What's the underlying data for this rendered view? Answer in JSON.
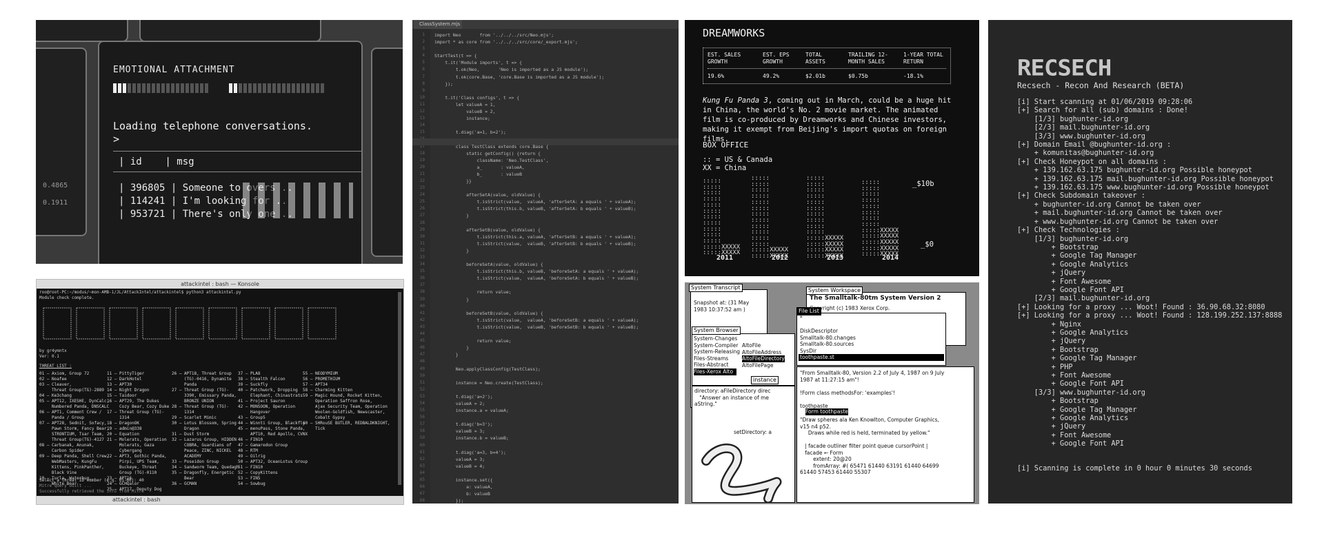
{
  "panel1": {
    "heading": "EMOTIONAL ATTACHMENT",
    "loading": "Loading telephone conversations.",
    "prompt": ">",
    "header": "| id    | msg",
    "rows": [
      "| 396805 | Someone to overs ..",
      "| 114241 | I'm looking for ..",
      "| 953721 | There's only one .."
    ],
    "side_nums": [
      "0.4865",
      "0.1911"
    ]
  },
  "panel2": {
    "window_title": "attackintel : bash — Konsole",
    "tab_label": "attackintel : bash",
    "cmd_line": "roo@root-PC:~/modus/~mon-AMB-1/JL/AttackIntel/attackintel$ python3 attackintel.py",
    "check_line": "Module check complete.",
    "author": "by gr4ymntx",
    "version": "Ver: 0.1",
    "threat_title": "THREAT LIST :",
    "col1": "01 – Axiom, Group 72\n02 – Noafee\n03 – Cleaver,\n     Threat Group(TG)-2889\n04 – Ke3chang\n05 – APT12, IXESHE, DynCalc,\n     Numbered Panda, DNSCALC\n06 – APT1, Comment Crew /\n     Panda / Group\n07 – APT28, Sednit, Sofacy,\n     Pawn Storm, Fancy Bear,\n     STRONTIUM, Tsar Team,\n     Threat Group(TG)-4127\n08 – Carbanak, Anunak,\n     Carbon Spider\n09 – Deep Panda, Shell Crew,\n     WebMasters, KungFu\n     Kittens, PinkPanther,\n     Black Vine\n10 – Turla, Waterbug,\n     White Bear",
    "col2": "11 – PittyTiger\n12 – DarkHotel\n13 – APT30\n14 – Night Dragon\n15 – Taidoor\n16 – APT29, The Dukes\n     Cozy Bear, Cozy Duke\n17 – Threat Group (TG)-\n     1314\n18 – DragonOK\n19 – admin@338\n20 – Equation\n21 – Molerats, Operation\n     Molerats, Gaza\n     Cybergang\n22 – APT3, Gothic Panda,\n     Pirpi, UPS Team,\n     Buckeye, Threat\n     Group (TG)-0110\n23 – APT16\n24 – GCHQalor\n25 – APT17, Deputy Dog",
    "col3": "26 – APT18, Threat Group\n     (TG)-0416, Dynamite\n     Panda\n27 – Threat Group (TG)-\n     3390, Emissary Panda,\n     BRONZE UNION\n28 – Threat Group (TG)-\n     1314\n29 – Scarlet Mimic\n30 – Lotus Blossom, Spring\n     Dragon\n31 – Dust Storm\n32 – Lazarus Group, HIDDEN\n     COBRA, Guardians of\n     Peace, ZINC, NICKEL\n     ACADEMY\n33 – Poseidon Group\n34 – Sandworm Team, Quedagh\n35 – Dragonfly, Energetic\n     Bear\n36 – GCMAN",
    "col4": "37 – PLA8\n38 – Stealth Falcon\n39 – Suckfly\n40 – Patchwork, Dropping\n     Elephant, Chinastrats\n41 – Project Sauron\n42 – MONSOON, Operation\n     Hangover\n43 – Group5\n44 – Winnti Group, Blackfly\n45 – menuPass, Stone Panda,\n     APT10, Red Apollo, CVNX\n46 – FIN10\n47 – Gamaredon Group\n48 – RTM\n49 – Oilrig\n50 – APT32, OceanLotus Group\n51 – FIN10\n52 – CopyKittens\n53 – FIN5\n54 – Sowbug",
    "col5": "55 – NEODYMIUM\n56 – PROMETHIUM\n57 – APT34\n58 – Charming Kitten\n59 – Magic Hound, Rocket Kitten,\n     Operation Saffron Rose,\n     Ajax Security Team, Operation\n     Woolen-Goldfish, Newscaster,\n     Cobalt Gypsy\n60 – SHRouSE BUTLER, REDBALDKNIGHT,\n     Tick",
    "prompt_line": "Select a threat ID number (e.g. 01-60): 40",
    "build_line": "Mitre query built ...",
    "result_line": "Successfully retrieved the info from Mitre"
  },
  "panel3": {
    "tab": "ClassSystem.mjs",
    "code": "import Neo       from '../../../src/Neo.mjs';\nimport * as core from '../../../src/core/_export.mjs';\n\nStartTest(t => {\n    t.it('Module imports', t => {\n        t.ok(Neo,       'Neo is imported as a JS module');\n        t.ok(core.Base, 'core.Base is imported as a JS module');\n    });\n\n    t.it('Class configs', t => {\n        let valueA = 1,\n            valueB = 2,\n            instance;\n\n        t.diag('a=1, b=2');\n\n        class TestClass extends core.Base {\n            static getConfig() {return {\n                className: 'Neo.TestClass',\n                a_       : valueA,\n                b_       : valueB\n            }}\n\n            afterSetA(value, oldValue) {\n                t.isStrict(value,  valueA, 'afterSetA: a equals ' + valueA);\n                t.isStrict(this.b, valueB, 'afterSetA: b equals ' + valueB);\n            }\n\n            afterSetB(value, oldValue) {\n                t.isStrict(this.a, valueA, 'afterSetB: a equals ' + valueA);\n                t.isStrict(value,  valueB, 'afterSetB: b equals ' + valueB);\n            }\n\n            beforeSetA(value, oldValue) {\n                t.isStrict(this.b, valueB, 'beforeSetA: a equals ' + valueA);\n                t.isStrict(value,  valueA, 'beforeSetA: b equals ' + valueB);\n\n                return value;\n            }\n\n            beforeSetB(value, oldValue) {\n                t.isStrict(value,  valueA, 'beforeSetB: a equals ' + valueA);\n                t.isStrict(value,  valueB, 'beforeSetB: b equals ' + valueB);\n\n                return value;\n            }\n        }\n\n        Neo.applyClassConfig(TestClass);\n\n        instance = Neo.create(TestClass);\n\n        t.diag('a=2');\n        valueA = 2;\n        instance.a = valueA;\n\n        t.diag('b=3');\n        valueB = 3;\n        instance.b = valueB;\n\n        t.diag('a=3, b=4');\n        valueA = 3;\n        valueB = 4;\n\n        instance.set({\n            a: valueA,\n            b: valueB\n        });\n    });\n});"
  },
  "panel4": {
    "title": "DREAMWORKS",
    "headers": [
      "EST. SALES\nGROWTH",
      "EST. EPS\nGROWTH",
      "TOTAL\nASSETS",
      "TRAILING 12-\nMONTH SALES",
      "1-YEAR TOTAL\nRETURN"
    ],
    "values": [
      "19.6%",
      "49.2%",
      "$2.01b",
      "$0.75b",
      "-18.1%"
    ],
    "para_italic": "Kung Fu Panda 3",
    "para_rest": ", coming out in March, could be a huge hit in China, the world's No. 2 movie market. The animated film is co-produced by Dreamworks and Chinese investors, making it exempt from Beijing's import quotas on foreign films.",
    "box_office": "BOX OFFICE",
    "legend1": ":: = US & Canada",
    "legend2": "XX = China",
    "top_label": "_$10b",
    "bottom_label": "_$0",
    "years": [
      "2011",
      "2012",
      "2013",
      "2014"
    ]
  },
  "panel5": {
    "transcript_label": "System Transcript",
    "transcript_text": "Snapshot at: (31 May\n1983 10:37:52 am )",
    "workspace_label": "System Workspace",
    "workspace_title": "The Smalltalk-80tm System Version 2",
    "workspace_sub": "Copyright (c) 1983 Xerox Corp.\nAll rights reserved.",
    "filelist_label": "File List",
    "filelist_items": "*\n\nDiskDescriptor\nSmalltalk-80.changes\nSmalltalk-80.sources\nSysDir",
    "filelist_selected": "toothpaste.st",
    "browser_label": "System Browser",
    "browser_col1": "System-Changes\nSystem-Compiler\nSystem-Releasing\nFiles-Streams\nFiles-Abstract",
    "browser_col1_sel": "Files-Xerox Alto",
    "browser_col2": "AltoFile\nAltoFileAddress",
    "browser_col2_sel": "AltoFileDirectory",
    "browser_col2b": "AltoFilePage",
    "instance_label": "instance",
    "dir_text": "directory: aFileDirectory direc\n   \"Answer an instance of me\naString.\"",
    "setdir": "setDirectory: a",
    "code_text": "\"From Smalltalk-80, Version 2.2 of July 4, 1987 on 9 July\n1987 at 11:27:15 am\"!\n\n!Form class methodsFor: 'examples'!\n\ntoothpaste",
    "form_sel": "Form toothpaste",
    "code_text2": "\"Draw spheres ala Ken Knowlton, Computer Graphics,\nv15 n4 p52.\n     Draws while red is held, terminated by yellow.\"\n\n   | facade outliner filter point queue cursorPoint |\n   facade ← Form\n        extent: 20@20\n        fromArray: #( 65471 61440 63191 61440 64699\n61440 57453 61440 55307"
  },
  "panel6": {
    "logo": "RECSECH",
    "subtitle": "Recsech - Recon And Research (BETA)",
    "log": "[i] Start scanning at 01/06/2019 09:28:06\n[+] Search for all (sub) domains : Done!\n    [1/3] bughunter-id.org\n    [2/3] mail.bughunter-id.org\n    [3/3] www.bughunter-id.org\n[+] Domain Email @bughunter-id.org :\n    + komunitas@bughunter-id.org\n[+] Check Honeypot on all domains :\n    + 139.162.63.175 bughunter-id.org Possible honeypot\n    + 139.162.63.175 mail.bughunter-id.org Possible honeypot\n    + 139.162.63.175 www.bughunter-id.org Possible honeypot\n[+] Check Subdomain takeover :\n    + bughunter-id.org Cannot be taken over\n    + mail.bughunter-id.org Cannot be taken over\n    + www.bughunter-id.org Cannot be taken over\n[+] Check Technologies :\n    [1/3] bughunter-id.org\n        + Bootstrap\n        + Google Tag Manager\n        + Google Analytics\n        + jQuery\n        + Font Awesome\n        + Google Font API\n    [2/3] mail.bughunter-id.org\n[+] Looking for a proxy ... Woot! Found : 36.90.68.32:8080\n[+] Looking for a proxy ... Woot! Found : 128.199.252.137:8888\n        + Nginx\n        + Google Analytics\n        + jQuery\n        + Bootstrap\n        + Google Tag Manager\n        + PHP\n        + Font Awesome\n        + Google Font API\n    [3/3] www.bughunter-id.org\n        + Bootstrap\n        + Google Tag Manager\n        + Google Analytics\n        + jQuery\n        + Font Awesome\n        + Google Font API",
    "done": "[i] Scanning is complete in 0 hour 0 minutes 30 seconds"
  }
}
